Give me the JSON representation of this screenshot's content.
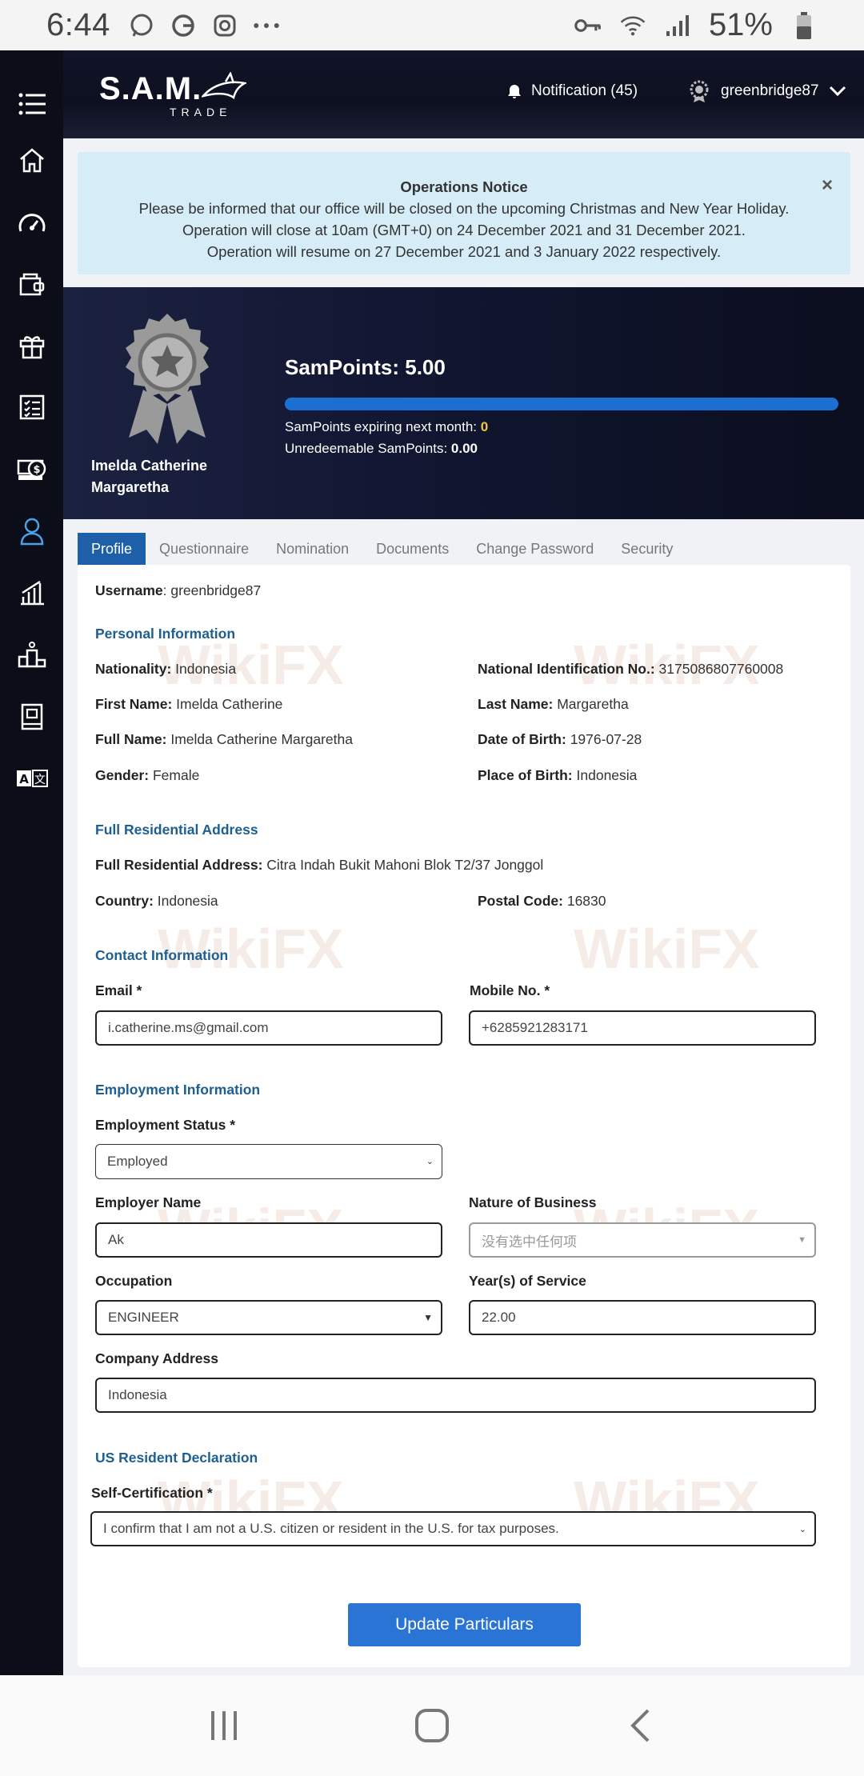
{
  "status_bar": {
    "time": "6:44",
    "battery": "51%",
    "icons": [
      "whatsapp-icon",
      "g-icon",
      "instagram-icon",
      "more-icon",
      "key-icon",
      "wifi-icon",
      "signal-icon",
      "battery-icon"
    ]
  },
  "header": {
    "logo_main": "S.A.M.",
    "logo_sub": "TRADE",
    "notification": "Notification (45)",
    "username": "greenbridge87"
  },
  "sidebar": {
    "icons": [
      "menu-icon",
      "home-icon",
      "dashboard-icon",
      "wallet-icon",
      "gift-icon",
      "checklist-icon",
      "money-icon",
      "profile-icon",
      "chart-icon",
      "ranking-icon",
      "book-icon",
      "translate-icon"
    ],
    "active": "profile-icon"
  },
  "notice": {
    "title": "Operations Notice",
    "line1": "Please be informed that our office will be closed on the upcoming Christmas and New Year Holiday.",
    "line2": "Operation will close at 10am (GMT+0) on 24 December 2021 and 31 December 2021.",
    "line3": "Operation will resume on 27 December 2021 and 3 January 2022 respectively.",
    "close": "×"
  },
  "banner": {
    "name": "Imelda Catherine Margaretha",
    "sampoints_title": "SamPoints: 5.00",
    "progress": 1.0,
    "expiring_label": "SamPoints expiring next month:",
    "expiring_value": "0",
    "unredeemable_label": "Unredeemable SamPoints:",
    "unredeemable_value": "0.00"
  },
  "tabs": [
    "Profile",
    "Questionnaire",
    "Nomination",
    "Documents",
    "Change Password",
    "Security"
  ],
  "profile": {
    "username_label": "Username",
    "username_value": ": greenbridge87",
    "personal_title": "Personal Information",
    "nationality_label": "Nationality:",
    "nationality_value": " Indonesia",
    "nid_label": "National Identification No.:",
    "nid_value": " 3175086807760008",
    "first_name_label": "First Name:",
    "first_name_value": " Imelda Catherine",
    "last_name_label": "Last Name:",
    "last_name_value": " Margaretha",
    "full_name_label": "Full Name:",
    "full_name_value": " Imelda Catherine Margaretha",
    "dob_label": "Date of Birth:",
    "dob_value": " 1976-07-28",
    "gender_label": "Gender:",
    "gender_value": " Female",
    "pob_label": "Place of Birth:",
    "pob_value": " Indonesia",
    "address_title": "Full Residential Address",
    "address_label": "Full Residential Address:",
    "address_value": " Citra Indah Bukit Mahoni Blok T2/37 Jonggol",
    "country_label": "Country:",
    "country_value": " Indonesia",
    "postal_label": "Postal Code:",
    "postal_value": " 16830",
    "contact_title": "Contact Information",
    "email_label": "Email *",
    "email_value": "i.catherine.ms@gmail.com",
    "mobile_label": "Mobile No. *",
    "mobile_value": "+6285921283171",
    "employment_title": "Employment Information",
    "emp_status_label": "Employment Status *",
    "emp_status_value": "Employed",
    "employer_label": "Employer Name",
    "employer_value": "Ak",
    "nature_label": "Nature of Business",
    "nature_value": "没有选中任何项",
    "occupation_label": "Occupation",
    "occupation_value": "ENGINEER",
    "years_label": "Year(s) of Service",
    "years_value": "22.00",
    "company_address_label": "Company Address",
    "company_address_value": "Indonesia",
    "us_title": "US Resident Declaration",
    "self_cert_label": "Self-Certification *",
    "self_cert_value": "I confirm that I am not a U.S. citizen or resident in the U.S. for tax purposes.",
    "update_button": "Update Particulars"
  },
  "watermark": "WikiFX",
  "colors": {
    "sidebar_bg": "#0b0d18",
    "accent": "#1e5faa",
    "button": "#2a74d6",
    "section_title": "#1e5f8f",
    "notice_bg": "#d6ecf7"
  }
}
